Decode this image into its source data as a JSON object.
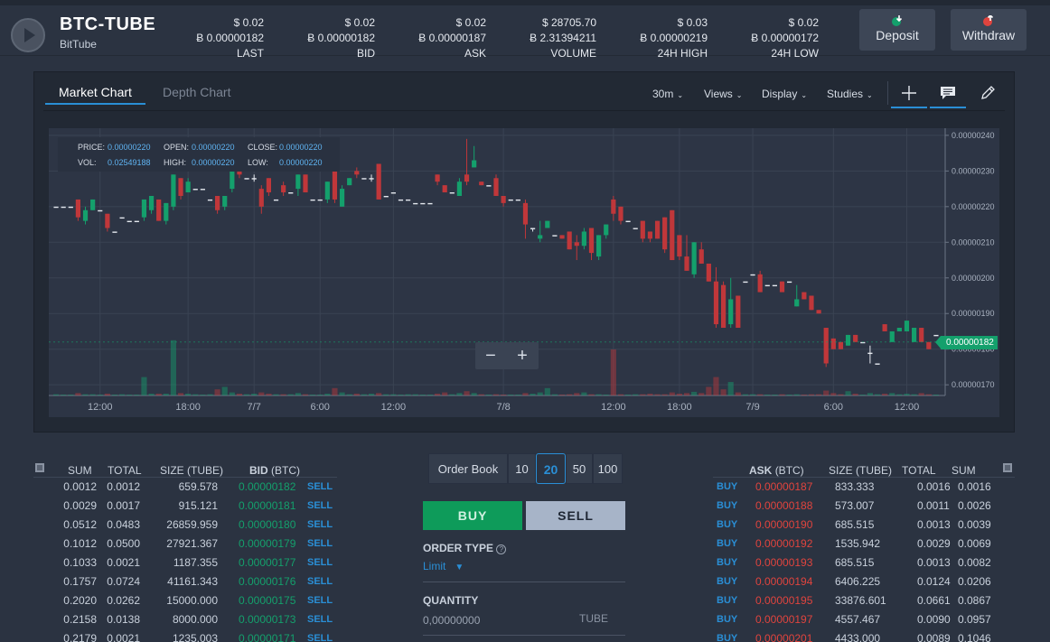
{
  "market": {
    "name": "BTC-TUBE",
    "sub": "BitTube"
  },
  "stats": [
    {
      "usd": "$ 0.02",
      "btc": "Ƀ 0.00000182",
      "label": "LAST"
    },
    {
      "usd": "$ 0.02",
      "btc": "Ƀ 0.00000182",
      "label": "BID"
    },
    {
      "usd": "$ 0.02",
      "btc": "Ƀ 0.00000187",
      "label": "ASK"
    },
    {
      "usd": "$ 28705.70",
      "btc": "Ƀ 2.31394211",
      "label": "VOLUME"
    },
    {
      "usd": "$ 0.03",
      "btc": "Ƀ 0.00000219",
      "label": "24H HIGH"
    },
    {
      "usd": "$ 0.02",
      "btc": "Ƀ 0.00000172",
      "label": "24H LOW"
    }
  ],
  "actions": {
    "deposit": "Deposit",
    "withdraw": "Withdraw"
  },
  "chart_tabs": {
    "market": "Market Chart",
    "depth": "Depth Chart"
  },
  "chart_controls": {
    "interval": "30m",
    "views": "Views",
    "display": "Display",
    "studies": "Studies"
  },
  "ohlc": {
    "price_k": "PRICE:",
    "price": "0.00000220",
    "open_k": "OPEN:",
    "open": "0.00000220",
    "close_k": "CLOSE:",
    "close": "0.00000220",
    "vol_k": "VOL:",
    "vol": "0.02549188",
    "high_k": "HIGH:",
    "high": "0.00000220",
    "low_k": "LOW:",
    "low": "0.00000220"
  },
  "price_tag": "0.00000182",
  "colors": {
    "up": "#14a06c",
    "down": "#c0373a",
    "accent": "#2a8fd6",
    "sell_price": "#e0443e"
  },
  "chart_data": {
    "type": "candlestick",
    "y_ticks": [
      "0.00000240",
      "0.00000230",
      "0.00000220",
      "0.00000210",
      "0.00000200",
      "0.00000190",
      "0.00000180",
      "0.00000170"
    ],
    "ylim": [
      1.67e-06,
      2.42e-06
    ],
    "x_ticks": [
      "12:00",
      "18:00",
      "7/7",
      "6:00",
      "12:00",
      "7/8",
      "12:00",
      "18:00",
      "7/9",
      "6:00",
      "12:00"
    ],
    "x_tick_index": [
      6,
      18,
      27,
      36,
      46,
      61,
      76,
      85,
      95,
      106,
      116
    ],
    "candles": [
      [
        220,
        220,
        220,
        220,
        2
      ],
      [
        220,
        220,
        220,
        220,
        1
      ],
      [
        220,
        220,
        220,
        220,
        1
      ],
      [
        222,
        217,
        222,
        216,
        4
      ],
      [
        216,
        219,
        220,
        215,
        2
      ],
      [
        219,
        222,
        222,
        219,
        2
      ],
      [
        219,
        219,
        219,
        219,
        1
      ],
      [
        218,
        214,
        218,
        213,
        3
      ],
      [
        213,
        213,
        213,
        213,
        1
      ],
      [
        217,
        217,
        217,
        217,
        2
      ],
      [
        216,
        216,
        216,
        216,
        1
      ],
      [
        216,
        216,
        216,
        216,
        1
      ],
      [
        217,
        222,
        222,
        216,
        30
      ],
      [
        219,
        223,
        223,
        218,
        3
      ],
      [
        222,
        216,
        222,
        216,
        3
      ],
      [
        216,
        221,
        221,
        215,
        3
      ],
      [
        220,
        229,
        229,
        219,
        90
      ],
      [
        228,
        223,
        228,
        222,
        4
      ],
      [
        224,
        227,
        228,
        224,
        3
      ],
      [
        225,
        225,
        225,
        225,
        2
      ],
      [
        225,
        225,
        225,
        225,
        1
      ],
      [
        222,
        222,
        222,
        222,
        2
      ],
      [
        223,
        219,
        223,
        218,
        10
      ],
      [
        220,
        223,
        223,
        219,
        14
      ],
      [
        225,
        230,
        230,
        224,
        5
      ],
      [
        230,
        229,
        231,
        228,
        3
      ],
      [
        228,
        228,
        228,
        228,
        2
      ],
      [
        228,
        228,
        229,
        227,
        3
      ],
      [
        225,
        220,
        226,
        218,
        5
      ],
      [
        228,
        224,
        228,
        223,
        3
      ],
      [
        222,
        222,
        222,
        222,
        2
      ],
      [
        226,
        224,
        227,
        223,
        2
      ],
      [
        224,
        224,
        224,
        224,
        2
      ],
      [
        225,
        229,
        229,
        223,
        4
      ],
      [
        229,
        224,
        229,
        224,
        2
      ],
      [
        222,
        222,
        222,
        222,
        1
      ],
      [
        222,
        222,
        222,
        222,
        1
      ],
      [
        222,
        227,
        227,
        221,
        3
      ],
      [
        230,
        222,
        230,
        221,
        12
      ],
      [
        220,
        225,
        226,
        220,
        5
      ],
      [
        226,
        228,
        228,
        226,
        2
      ],
      [
        230,
        229,
        231,
        228,
        3
      ],
      [
        228,
        228,
        228,
        228,
        2
      ],
      [
        228,
        228,
        229,
        227,
        3
      ],
      [
        232,
        222,
        232,
        222,
        4
      ],
      [
        223,
        223,
        223,
        223,
        2
      ],
      [
        224,
        224,
        224,
        224,
        2
      ],
      [
        222,
        222,
        222,
        222,
        1
      ],
      [
        222,
        222,
        222,
        222,
        2
      ],
      [
        221,
        221,
        221,
        221,
        2
      ],
      [
        221,
        221,
        221,
        221,
        1
      ],
      [
        221,
        221,
        221,
        221,
        1
      ],
      [
        229,
        227,
        229,
        226,
        3
      ],
      [
        226,
        224,
        226,
        224,
        5
      ],
      [
        224,
        224,
        224,
        224,
        2
      ],
      [
        223,
        227,
        228,
        223,
        4
      ],
      [
        229,
        227,
        239,
        226,
        7
      ],
      [
        231,
        233,
        237,
        231,
        4
      ],
      [
        227,
        226,
        227,
        226,
        2
      ],
      [
        226,
        226,
        226,
        226,
        1
      ],
      [
        228,
        223,
        229,
        223,
        2
      ],
      [
        223,
        221,
        223,
        220,
        1
      ],
      [
        222,
        222,
        222,
        222,
        1
      ],
      [
        222,
        222,
        222,
        222,
        1
      ],
      [
        221,
        215,
        222,
        211,
        4
      ],
      [
        214,
        214,
        214,
        213,
        3
      ],
      [
        211,
        212,
        216,
        210,
        5
      ],
      [
        214,
        216,
        216,
        214,
        12
      ],
      [
        212,
        212,
        212,
        212,
        2
      ],
      [
        212,
        211,
        212,
        211,
        1
      ],
      [
        213,
        208,
        213,
        208,
        2
      ],
      [
        210,
        209,
        212,
        205,
        4
      ],
      [
        209,
        213,
        214,
        208,
        5
      ],
      [
        214,
        207,
        214,
        205,
        2
      ],
      [
        206,
        212,
        212,
        205,
        2
      ],
      [
        212,
        215,
        215,
        211,
        1
      ],
      [
        222,
        218,
        223,
        216,
        75
      ],
      [
        220,
        216,
        220,
        215,
        2
      ],
      [
        216,
        216,
        216,
        216,
        1
      ],
      [
        214,
        214,
        214,
        214,
        2
      ],
      [
        216,
        211,
        216,
        210,
        2
      ],
      [
        213,
        211,
        213,
        210,
        3
      ],
      [
        216,
        211,
        216,
        211,
        2
      ],
      [
        217,
        208,
        217,
        207,
        2
      ],
      [
        219,
        205,
        219,
        205,
        5
      ],
      [
        212,
        206,
        212,
        205,
        3
      ],
      [
        206,
        202,
        212,
        202,
        4
      ],
      [
        201,
        210,
        210,
        200,
        6
      ],
      [
        208,
        204,
        210,
        204,
        4
      ],
      [
        204,
        199,
        204,
        199,
        14
      ],
      [
        199,
        187,
        203,
        186,
        30
      ],
      [
        198,
        186,
        199,
        186,
        10
      ],
      [
        187,
        194,
        200,
        186,
        22
      ],
      [
        195,
        186,
        195,
        186,
        5
      ],
      [
        199,
        199,
        199,
        199,
        2
      ],
      [
        201,
        201,
        201,
        201,
        2
      ],
      [
        201,
        196,
        202,
        196,
        2
      ],
      [
        198,
        198,
        198,
        198,
        1
      ],
      [
        198,
        198,
        198,
        198,
        1
      ],
      [
        199,
        196,
        199,
        196,
        2
      ],
      [
        199,
        199,
        199,
        199,
        1
      ],
      [
        192,
        194,
        198,
        192,
        2
      ],
      [
        196,
        194,
        196,
        194,
        1
      ],
      [
        195,
        191,
        195,
        191,
        2
      ],
      [
        191,
        190,
        191,
        190,
        2
      ],
      [
        186,
        176,
        186,
        175,
        8
      ],
      [
        183,
        180,
        183,
        180,
        4
      ],
      [
        182,
        180,
        182,
        180,
        2
      ],
      [
        181,
        184,
        184,
        181,
        7
      ],
      [
        184,
        182,
        184,
        182,
        3
      ],
      [
        182,
        182,
        182,
        182,
        1
      ],
      [
        179,
        179,
        181,
        176,
        4
      ],
      [
        176,
        176,
        176,
        176,
        2
      ],
      [
        187,
        185,
        187,
        185,
        3
      ],
      [
        182,
        185,
        185,
        182,
        4
      ],
      [
        185,
        186,
        186,
        185,
        2
      ],
      [
        185,
        188,
        188,
        185,
        3
      ],
      [
        182,
        186,
        186,
        182,
        2
      ],
      [
        186,
        182,
        186,
        182,
        4
      ],
      [
        182,
        180,
        182,
        180,
        2
      ],
      [
        184,
        184,
        184,
        184,
        1
      ]
    ]
  },
  "bids": {
    "headers": {
      "sum": "SUM",
      "total": "TOTAL",
      "size": "SIZE (TUBE)",
      "bid": "BID",
      "bid_unit": "(BTC)"
    },
    "action": "SELL",
    "rows": [
      {
        "sum": "0.0012",
        "total": "0.0012",
        "size": "659.578",
        "price": "0.00000182"
      },
      {
        "sum": "0.0029",
        "total": "0.0017",
        "size": "915.121",
        "price": "0.00000181"
      },
      {
        "sum": "0.0512",
        "total": "0.0483",
        "size": "26859.959",
        "price": "0.00000180"
      },
      {
        "sum": "0.1012",
        "total": "0.0500",
        "size": "27921.367",
        "price": "0.00000179"
      },
      {
        "sum": "0.1033",
        "total": "0.0021",
        "size": "1187.355",
        "price": "0.00000177"
      },
      {
        "sum": "0.1757",
        "total": "0.0724",
        "size": "41161.343",
        "price": "0.00000176"
      },
      {
        "sum": "0.2020",
        "total": "0.0262",
        "size": "15000.000",
        "price": "0.00000175"
      },
      {
        "sum": "0.2158",
        "total": "0.0138",
        "size": "8000.000",
        "price": "0.00000173"
      },
      {
        "sum": "0.2179",
        "total": "0.0021",
        "size": "1235.003",
        "price": "0.00000171"
      }
    ]
  },
  "asks": {
    "headers": {
      "ask": "ASK",
      "ask_unit": "(BTC)",
      "size": "SIZE (TUBE)",
      "total": "TOTAL",
      "sum": "SUM"
    },
    "action": "BUY",
    "rows": [
      {
        "price": "0.00000187",
        "size": "833.333",
        "total": "0.0016",
        "sum": "0.0016"
      },
      {
        "price": "0.00000188",
        "size": "573.007",
        "total": "0.0011",
        "sum": "0.0026"
      },
      {
        "price": "0.00000190",
        "size": "685.515",
        "total": "0.0013",
        "sum": "0.0039"
      },
      {
        "price": "0.00000192",
        "size": "1535.942",
        "total": "0.0029",
        "sum": "0.0069"
      },
      {
        "price": "0.00000193",
        "size": "685.515",
        "total": "0.0013",
        "sum": "0.0082"
      },
      {
        "price": "0.00000194",
        "size": "6406.225",
        "total": "0.0124",
        "sum": "0.0206"
      },
      {
        "price": "0.00000195",
        "size": "33876.601",
        "total": "0.0661",
        "sum": "0.0867"
      },
      {
        "price": "0.00000197",
        "size": "4557.467",
        "total": "0.0090",
        "sum": "0.0957"
      },
      {
        "price": "0.00000201",
        "size": "4433.000",
        "total": "0.0089",
        "sum": "0.1046"
      }
    ]
  },
  "orderbook": {
    "label": "Order Book",
    "depths": [
      "10",
      "20",
      "50",
      "100"
    ],
    "selected": "20"
  },
  "order_form": {
    "buy": "BUY",
    "sell": "SELL",
    "type_label": "ORDER TYPE",
    "type_value": "Limit",
    "quantity_label": "QUANTITY",
    "quantity_placeholder": "0,00000000",
    "quantity_unit": "TUBE"
  }
}
